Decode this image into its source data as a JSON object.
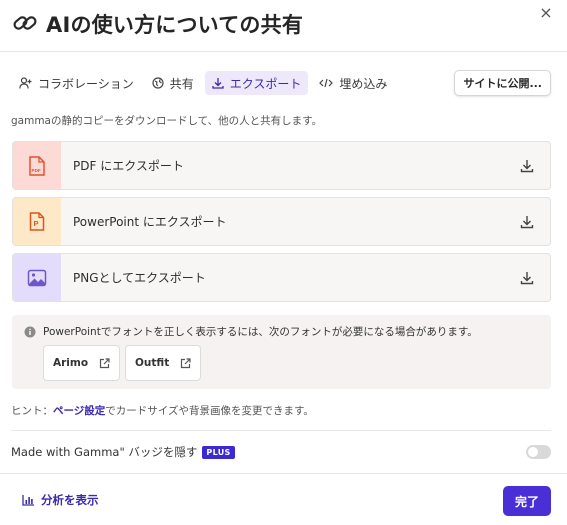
{
  "header": {
    "title": "AIの使い方についての共有",
    "close_label": "×"
  },
  "tabs": [
    {
      "label": "コラボレーション",
      "icon": "add-user-icon",
      "active": false
    },
    {
      "label": "共有",
      "icon": "globe-icon",
      "active": false
    },
    {
      "label": "エクスポート",
      "icon": "download-icon",
      "active": true
    },
    {
      "label": "埋め込み",
      "icon": "code-icon",
      "active": false
    }
  ],
  "publish_button": "サイトに公開...",
  "description": "gammaの静的コピーをダウンロードして、他の人と共有します。",
  "exports": [
    {
      "label": "PDF にエクスポート",
      "icon": "pdf-file-icon",
      "color": "#e2522f",
      "bg": "#fddad6"
    },
    {
      "label": "PowerPoint にエクスポート",
      "icon": "powerpoint-file-icon",
      "color": "#d9571e",
      "bg": "#fde8c8"
    },
    {
      "label": "PNGとしてエクスポート",
      "icon": "image-icon",
      "color": "#6d57c9",
      "bg": "#e3dcfa"
    }
  ],
  "fonts_notice": {
    "message": "PowerPointでフォントを正しく表示するには、次のフォントが必要になる場合があります。",
    "fonts": [
      "Arimo",
      "Outfit"
    ]
  },
  "hint": {
    "prefix": "ヒント：",
    "link": "ページ設定",
    "suffix": "でカードサイズや背景画像を変更できます。"
  },
  "badge": {
    "label": "Made with Gamma\" バッジを隠す",
    "tag": "PLUS",
    "enabled": false
  },
  "footer": {
    "analytics_label": "分析を表示",
    "done_label": "完了"
  },
  "colors": {
    "accent": "#4b2fd6",
    "accent_text": "#3b2ab0",
    "tab_active_bg": "#ede9fb"
  }
}
